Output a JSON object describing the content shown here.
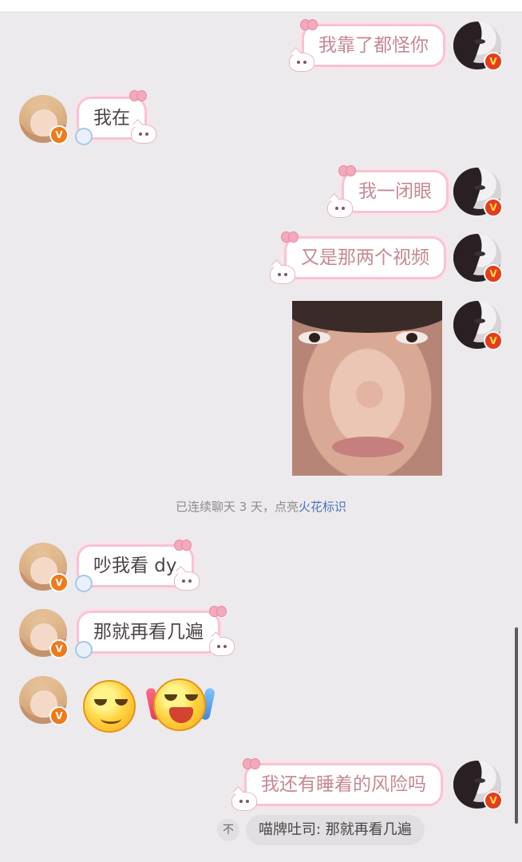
{
  "messages": [
    {
      "side": "self",
      "text": "我靠了都怪你"
    },
    {
      "side": "peer",
      "text": "我在"
    },
    {
      "side": "self",
      "text": "我一闭眼"
    },
    {
      "side": "self",
      "text": "又是那两个视频"
    },
    {
      "side": "self",
      "type": "image"
    },
    {
      "side": "peer",
      "text": "吵我看 dy"
    },
    {
      "side": "peer",
      "text": "那就再看几遍"
    },
    {
      "side": "peer",
      "type": "emoji"
    },
    {
      "side": "self",
      "text": "我还有睡着的风险吗"
    }
  ],
  "notice": {
    "text": "已连续聊天 3 天，点亮",
    "link": "火花标识"
  },
  "badge_letter": "V",
  "quote": {
    "close_glyph": "不",
    "text": "喵牌吐司: 那就再看几遍"
  },
  "colors": {
    "background": "#eceaed",
    "bubble_border": "#f6c4d2",
    "self_text": "#c78894",
    "link": "#4a72b8"
  }
}
